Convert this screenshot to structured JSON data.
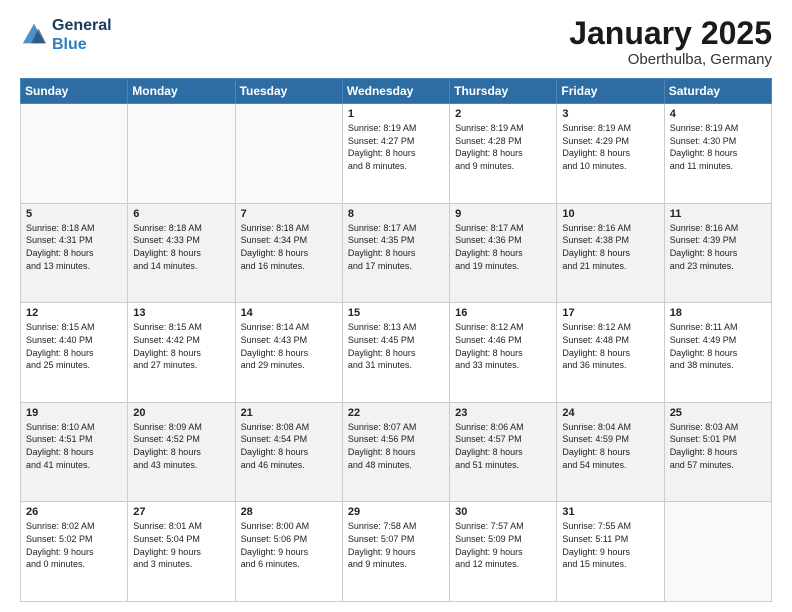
{
  "header": {
    "logo_line1": "General",
    "logo_line2": "Blue",
    "month": "January 2025",
    "location": "Oberthulba, Germany"
  },
  "weekdays": [
    "Sunday",
    "Monday",
    "Tuesday",
    "Wednesday",
    "Thursday",
    "Friday",
    "Saturday"
  ],
  "weeks": [
    [
      {
        "day": "",
        "info": ""
      },
      {
        "day": "",
        "info": ""
      },
      {
        "day": "",
        "info": ""
      },
      {
        "day": "1",
        "info": "Sunrise: 8:19 AM\nSunset: 4:27 PM\nDaylight: 8 hours\nand 8 minutes."
      },
      {
        "day": "2",
        "info": "Sunrise: 8:19 AM\nSunset: 4:28 PM\nDaylight: 8 hours\nand 9 minutes."
      },
      {
        "day": "3",
        "info": "Sunrise: 8:19 AM\nSunset: 4:29 PM\nDaylight: 8 hours\nand 10 minutes."
      },
      {
        "day": "4",
        "info": "Sunrise: 8:19 AM\nSunset: 4:30 PM\nDaylight: 8 hours\nand 11 minutes."
      }
    ],
    [
      {
        "day": "5",
        "info": "Sunrise: 8:18 AM\nSunset: 4:31 PM\nDaylight: 8 hours\nand 13 minutes."
      },
      {
        "day": "6",
        "info": "Sunrise: 8:18 AM\nSunset: 4:33 PM\nDaylight: 8 hours\nand 14 minutes."
      },
      {
        "day": "7",
        "info": "Sunrise: 8:18 AM\nSunset: 4:34 PM\nDaylight: 8 hours\nand 16 minutes."
      },
      {
        "day": "8",
        "info": "Sunrise: 8:17 AM\nSunset: 4:35 PM\nDaylight: 8 hours\nand 17 minutes."
      },
      {
        "day": "9",
        "info": "Sunrise: 8:17 AM\nSunset: 4:36 PM\nDaylight: 8 hours\nand 19 minutes."
      },
      {
        "day": "10",
        "info": "Sunrise: 8:16 AM\nSunset: 4:38 PM\nDaylight: 8 hours\nand 21 minutes."
      },
      {
        "day": "11",
        "info": "Sunrise: 8:16 AM\nSunset: 4:39 PM\nDaylight: 8 hours\nand 23 minutes."
      }
    ],
    [
      {
        "day": "12",
        "info": "Sunrise: 8:15 AM\nSunset: 4:40 PM\nDaylight: 8 hours\nand 25 minutes."
      },
      {
        "day": "13",
        "info": "Sunrise: 8:15 AM\nSunset: 4:42 PM\nDaylight: 8 hours\nand 27 minutes."
      },
      {
        "day": "14",
        "info": "Sunrise: 8:14 AM\nSunset: 4:43 PM\nDaylight: 8 hours\nand 29 minutes."
      },
      {
        "day": "15",
        "info": "Sunrise: 8:13 AM\nSunset: 4:45 PM\nDaylight: 8 hours\nand 31 minutes."
      },
      {
        "day": "16",
        "info": "Sunrise: 8:12 AM\nSunset: 4:46 PM\nDaylight: 8 hours\nand 33 minutes."
      },
      {
        "day": "17",
        "info": "Sunrise: 8:12 AM\nSunset: 4:48 PM\nDaylight: 8 hours\nand 36 minutes."
      },
      {
        "day": "18",
        "info": "Sunrise: 8:11 AM\nSunset: 4:49 PM\nDaylight: 8 hours\nand 38 minutes."
      }
    ],
    [
      {
        "day": "19",
        "info": "Sunrise: 8:10 AM\nSunset: 4:51 PM\nDaylight: 8 hours\nand 41 minutes."
      },
      {
        "day": "20",
        "info": "Sunrise: 8:09 AM\nSunset: 4:52 PM\nDaylight: 8 hours\nand 43 minutes."
      },
      {
        "day": "21",
        "info": "Sunrise: 8:08 AM\nSunset: 4:54 PM\nDaylight: 8 hours\nand 46 minutes."
      },
      {
        "day": "22",
        "info": "Sunrise: 8:07 AM\nSunset: 4:56 PM\nDaylight: 8 hours\nand 48 minutes."
      },
      {
        "day": "23",
        "info": "Sunrise: 8:06 AM\nSunset: 4:57 PM\nDaylight: 8 hours\nand 51 minutes."
      },
      {
        "day": "24",
        "info": "Sunrise: 8:04 AM\nSunset: 4:59 PM\nDaylight: 8 hours\nand 54 minutes."
      },
      {
        "day": "25",
        "info": "Sunrise: 8:03 AM\nSunset: 5:01 PM\nDaylight: 8 hours\nand 57 minutes."
      }
    ],
    [
      {
        "day": "26",
        "info": "Sunrise: 8:02 AM\nSunset: 5:02 PM\nDaylight: 9 hours\nand 0 minutes."
      },
      {
        "day": "27",
        "info": "Sunrise: 8:01 AM\nSunset: 5:04 PM\nDaylight: 9 hours\nand 3 minutes."
      },
      {
        "day": "28",
        "info": "Sunrise: 8:00 AM\nSunset: 5:06 PM\nDaylight: 9 hours\nand 6 minutes."
      },
      {
        "day": "29",
        "info": "Sunrise: 7:58 AM\nSunset: 5:07 PM\nDaylight: 9 hours\nand 9 minutes."
      },
      {
        "day": "30",
        "info": "Sunrise: 7:57 AM\nSunset: 5:09 PM\nDaylight: 9 hours\nand 12 minutes."
      },
      {
        "day": "31",
        "info": "Sunrise: 7:55 AM\nSunset: 5:11 PM\nDaylight: 9 hours\nand 15 minutes."
      },
      {
        "day": "",
        "info": ""
      }
    ]
  ]
}
